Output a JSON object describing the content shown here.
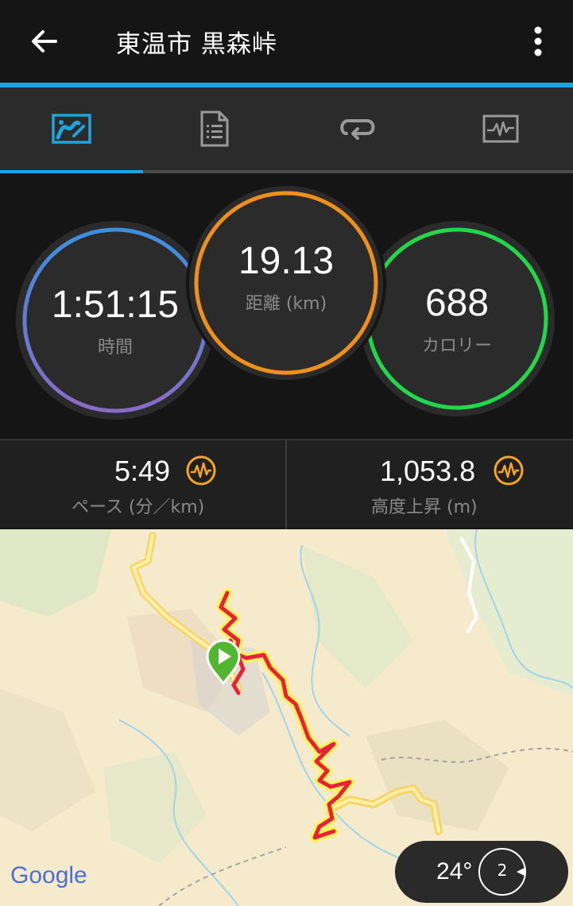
{
  "app_bar": {
    "title": "東温市 黒森峠",
    "back_icon": "arrow-left-icon",
    "more_icon": "more-vertical-icon"
  },
  "tabs": [
    {
      "name": "overview",
      "icon": "map-chart-icon",
      "active": true
    },
    {
      "name": "details",
      "icon": "document-list-icon",
      "active": false
    },
    {
      "name": "laps",
      "icon": "loop-icon",
      "active": false
    },
    {
      "name": "charts",
      "icon": "activity-graph-icon",
      "active": false
    }
  ],
  "summary": {
    "time": {
      "value": "1:51:15",
      "label": "時間"
    },
    "distance": {
      "value": "19.13",
      "label": "距離 (km)"
    },
    "calories": {
      "value": "688",
      "label": "カロリー"
    }
  },
  "stats": {
    "pace": {
      "value": "5:49",
      "label": "ペース (分／km)",
      "icon": "performance-wave-icon"
    },
    "elevation": {
      "value": "1,053.8",
      "label": "高度上昇 (m)",
      "icon": "performance-wave-icon"
    }
  },
  "map": {
    "attribution": "Google",
    "start_marker_icon": "play-pin-icon"
  },
  "weather": {
    "temperature": "24°",
    "wind_speed": "2",
    "wind_icon": "wind-direction-icon"
  },
  "colors": {
    "accent_blue": "#1ea5e0",
    "ring_time_start": "#3d8fe0",
    "ring_time_end": "#8a6bc8",
    "ring_distance": "#f0901c",
    "ring_calories": "#22d84a",
    "stat_icon": "#f5a623",
    "route_red": "#e8213a",
    "route_halo": "#ffe45a"
  }
}
